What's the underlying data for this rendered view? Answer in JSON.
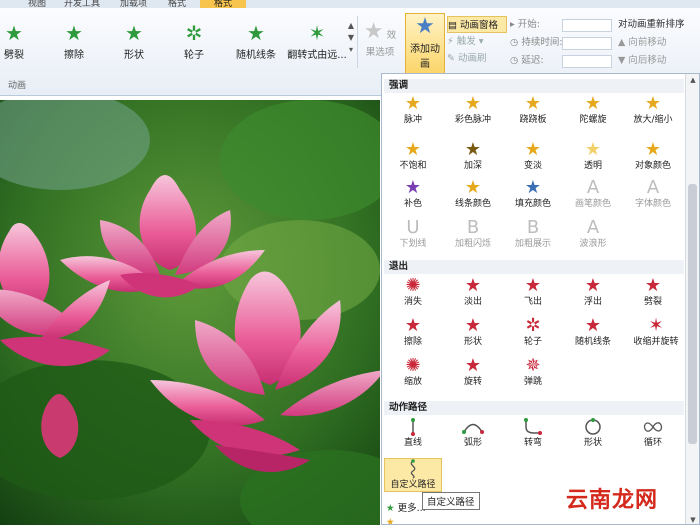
{
  "tabs": {
    "t1": "视图",
    "t2": "开发工具",
    "t3": "加载项",
    "t4": "格式",
    "t5": "格式"
  },
  "ribbon": {
    "gallery": [
      "劈裂",
      "擦除",
      "形状",
      "轮子",
      "随机线条",
      "翻转式由远..."
    ],
    "effect_options": "效果选项",
    "add_animation": "添加动画",
    "animation_pane": "动画窗格",
    "trigger": "触发",
    "animation_painter": "动画刷",
    "start_label": "开始:",
    "duration_label": "持续时间:",
    "delay_label": "延迟:",
    "reorder_title": "对动画重新排序",
    "move_earlier": "向前移动",
    "move_later": "向后移动",
    "group_label": "动画"
  },
  "panel": {
    "emphasis_header": "强调",
    "emphasis": [
      "脉冲",
      "彩色脉冲",
      "跷跷板",
      "陀螺旋",
      "放大/缩小",
      "不饱和",
      "加深",
      "变淡",
      "透明",
      "对象颜色",
      "补色",
      "线条颜色",
      "填充颜色",
      "画笔颜色",
      "字体颜色",
      "下划线",
      "加粗闪烁",
      "加粗展示",
      "波浪形"
    ],
    "exit_header": "退出",
    "exit": [
      "消失",
      "淡出",
      "飞出",
      "浮出",
      "劈裂",
      "擦除",
      "形状",
      "轮子",
      "随机线条",
      "收缩并旋转",
      "缩放",
      "旋转",
      "弹跳"
    ],
    "path_header": "动作路径",
    "paths": [
      "直线",
      "弧形",
      "转弯",
      "形状",
      "循环",
      "自定义路径"
    ],
    "more_label": "更多..."
  },
  "tooltip": "自定义路径",
  "watermark": "云南龙网"
}
